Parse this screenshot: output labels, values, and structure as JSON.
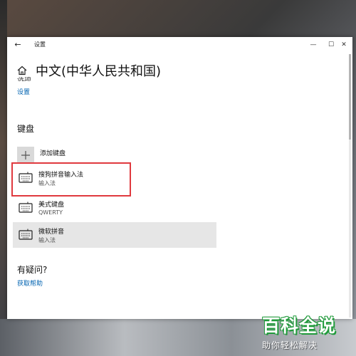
{
  "window": {
    "title": "设置",
    "controls": {
      "minimize": "—",
      "maximize": "☐",
      "close": "✕"
    }
  },
  "header": {
    "title": "中文(中华人民共和国)",
    "cut_off_text": "选项",
    "settings_link": "设置"
  },
  "keyboard_section": {
    "title": "键盘",
    "add_label": "添加键盘",
    "items": [
      {
        "name": "搜狗拼音输入法",
        "sub": "输入法",
        "highlighted": true
      },
      {
        "name": "美式键盘",
        "sub": "QWERTY"
      },
      {
        "name": "微软拼音",
        "sub": "输入法",
        "selected": true
      }
    ]
  },
  "help_section": {
    "title": "有疑问?",
    "link": "获取帮助"
  },
  "watermark": {
    "logo": "百科全说",
    "slogan": "助你轻松解决"
  },
  "colors": {
    "link": "#0063b1",
    "highlight_border": "#e0393e",
    "selected_bg": "#e6e6e6",
    "watermark_green": "#1f9a3a"
  }
}
